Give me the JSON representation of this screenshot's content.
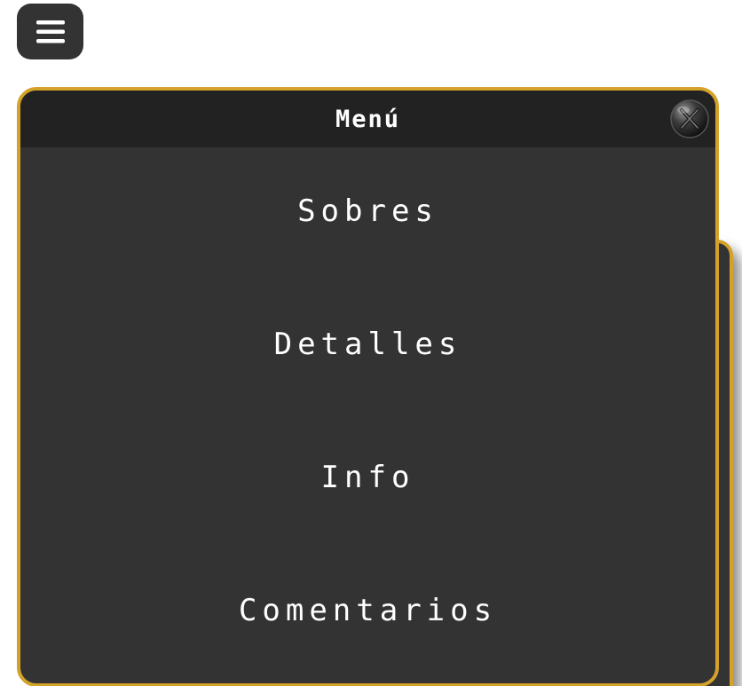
{
  "nav_button": {
    "icon": "hamburger-icon"
  },
  "menu": {
    "title": "Menú",
    "close_icon": "close-orb-icon",
    "items": [
      {
        "label": "Sobres"
      },
      {
        "label": "Detalles"
      },
      {
        "label": "Info"
      },
      {
        "label": "Comentarios"
      }
    ]
  },
  "colors": {
    "panel_bg": "#333333",
    "header_bg": "#222222",
    "border": "#d4a22a",
    "text": "#ffffff"
  }
}
